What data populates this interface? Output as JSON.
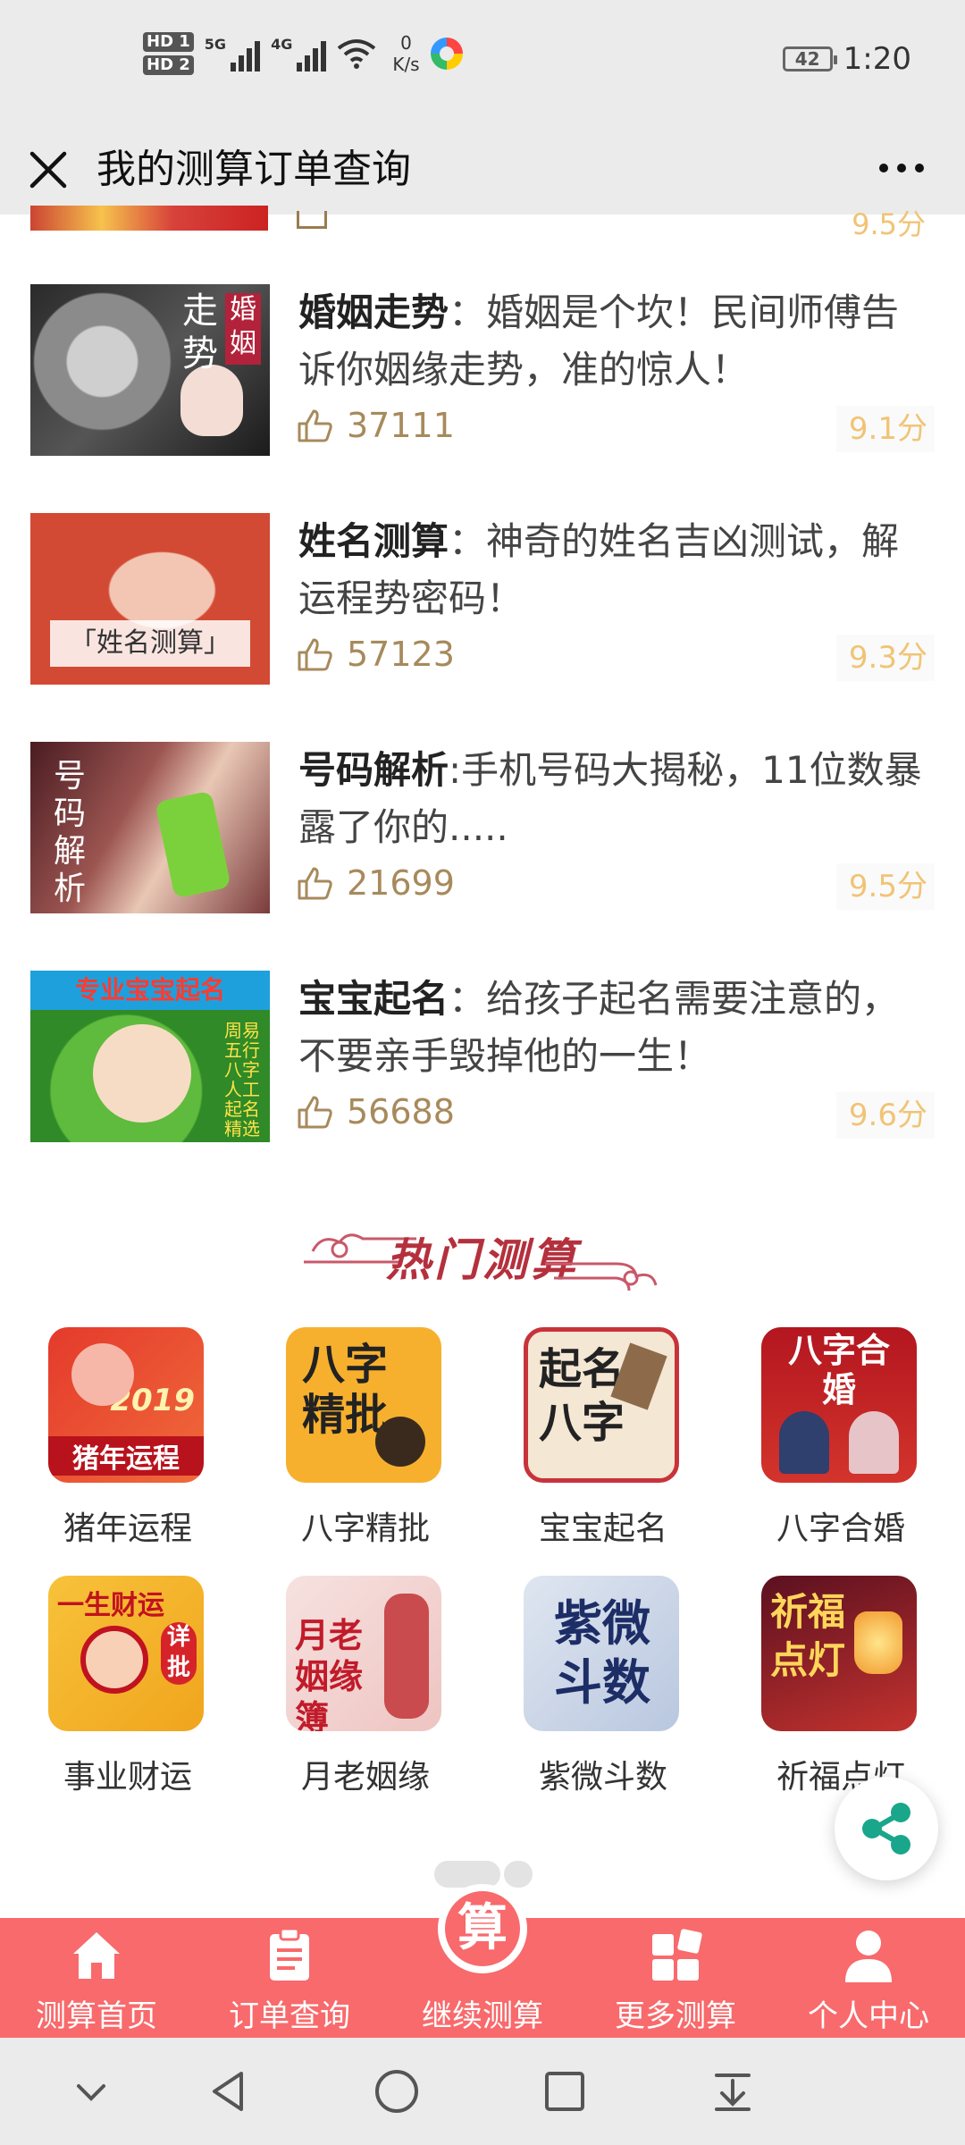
{
  "status_bar": {
    "hd1": "HD 1",
    "hd2": "HD 2",
    "net1": "5G",
    "net2": "4G",
    "speed_value": "0",
    "speed_unit": "K/s",
    "battery": "42",
    "time": "1:20"
  },
  "header": {
    "title": "我的测算订单查询",
    "close_icon": "close-icon",
    "more_icon": "more-icon"
  },
  "partial_item": {
    "score": "9.5分"
  },
  "items": [
    {
      "title": "婚姻走势",
      "sep": "：",
      "desc": "婚姻是个坎！民间师傅告诉你姻缘走势，准的惊人！",
      "likes": "37111",
      "score": "9.1分",
      "thumb_v1": "婚姻",
      "thumb_v2": "走势"
    },
    {
      "title": "姓名测算",
      "sep": "：",
      "desc": "神奇的姓名吉凶测试，解运程势密码！",
      "likes": "57123",
      "score": "9.3分",
      "thumb_band": "「姓名测算」"
    },
    {
      "title": "号码解析",
      "sep": ":",
      "desc": "手机号码大揭秘，11位数暴露了你的.....",
      "likes": "21699",
      "score": "9.5分",
      "thumb_v": "号码解析"
    },
    {
      "title": "宝宝起名",
      "sep": "：",
      "desc": "给孩子起名需要注意的，不要亲手毁掉他的一生！",
      "likes": "56688",
      "score": "9.6分",
      "thumb_top": "专业宝宝起名",
      "thumb_side": "周易五行八字人工起名精选"
    }
  ],
  "section": {
    "title": "热门测算"
  },
  "grid": [
    {
      "label": "猪年运程",
      "icon_text": "猪年运程",
      "badge": "2019",
      "color1": "#e43a2c",
      "color2": "#f7b33b"
    },
    {
      "label": "八字精批",
      "icon_text": "八字精批",
      "color1": "#f7b02e",
      "color2": "#f3c24a"
    },
    {
      "label": "宝宝起名",
      "icon_text": "起名八字",
      "color1": "#f4e7d4",
      "color2": "#e9d4b4"
    },
    {
      "label": "八字合婚",
      "icon_text": "八字合婚",
      "color1": "#b3161f",
      "color2": "#d3342c"
    },
    {
      "label": "事业财运",
      "icon_text": "一生财运",
      "badge": "详批",
      "color1": "#f7c23a",
      "color2": "#f0a51d"
    },
    {
      "label": "月老姻缘",
      "icon_text": "月老姻缘簿",
      "color1": "#f6e2e0",
      "color2": "#eec4c1"
    },
    {
      "label": "紫微斗数",
      "icon_text": "紫微斗数",
      "color1": "#dfe6f0",
      "color2": "#b9c7df"
    },
    {
      "label": "祈福点灯",
      "icon_text": "祈福点灯",
      "color1": "#5b1020",
      "color2": "#c3322e"
    }
  ],
  "tabs": [
    {
      "label": "测算首页",
      "icon": "home-icon"
    },
    {
      "label": "订单查询",
      "icon": "clipboard-icon"
    },
    {
      "label": "继续测算",
      "icon": "suan-badge-icon",
      "badge": "算"
    },
    {
      "label": "更多测算",
      "icon": "grid-icon"
    },
    {
      "label": "个人中心",
      "icon": "person-icon"
    }
  ],
  "colors": {
    "accent": "#f86a6c",
    "likes": "#a78a5c",
    "score": "#f0c476",
    "section_title": "#b5303d",
    "share": "#1aa68a"
  }
}
